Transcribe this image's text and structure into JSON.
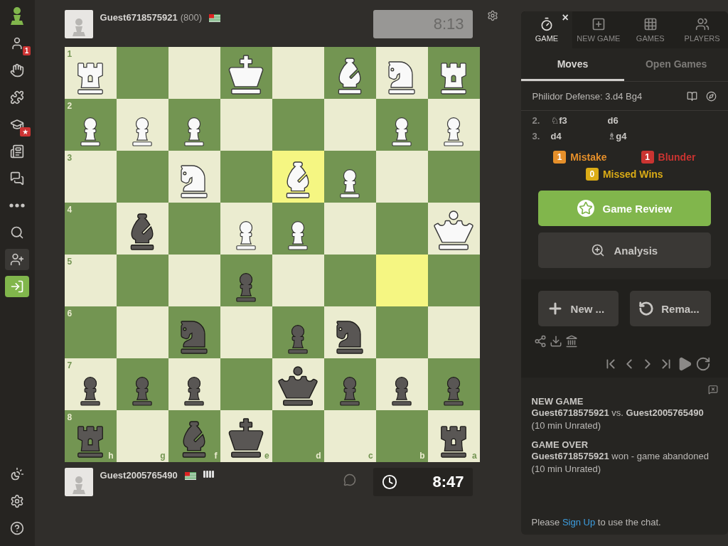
{
  "sidebar": {
    "top_items": [
      {
        "kind": "logo"
      },
      {
        "kind": "plain",
        "badge": "1"
      },
      {
        "kind": "plain"
      },
      {
        "kind": "plain"
      },
      {
        "kind": "plain",
        "badge": "★"
      },
      {
        "kind": "plain"
      },
      {
        "kind": "plain"
      },
      {
        "kind": "plain"
      },
      {
        "kind": "plain"
      },
      {
        "kind": "muted"
      },
      {
        "kind": "primary"
      }
    ]
  },
  "top_player": {
    "name": "Guest6718575921",
    "rating": "(800)",
    "clock": "8:13",
    "clock_active": false
  },
  "bottom_player": {
    "name": "Guest2005765490",
    "clock": "8:47",
    "clock_active": true
  },
  "board": {
    "files": [
      "h",
      "g",
      "f",
      "e",
      "d",
      "c",
      "b",
      "a"
    ],
    "rows": [
      {
        "rank": "1",
        "squares": [
          {
            "kind": "rook",
            "white": true,
            "highlighted": false
          },
          {
            "kind": "empty",
            "highlighted": false
          },
          {
            "kind": "empty",
            "highlighted": false
          },
          {
            "kind": "king",
            "white": true,
            "highlighted": false
          },
          {
            "kind": "empty",
            "highlighted": false
          },
          {
            "kind": "bishop",
            "white": true,
            "highlighted": false
          },
          {
            "kind": "knight",
            "white": true,
            "highlighted": false
          },
          {
            "kind": "rook",
            "white": true,
            "highlighted": false
          }
        ]
      },
      {
        "rank": "2",
        "squares": [
          {
            "kind": "pawn",
            "white": true,
            "highlighted": false
          },
          {
            "kind": "pawn",
            "white": true,
            "highlighted": false
          },
          {
            "kind": "pawn",
            "white": true,
            "highlighted": false
          },
          {
            "kind": "empty",
            "highlighted": false
          },
          {
            "kind": "empty",
            "highlighted": false
          },
          {
            "kind": "empty",
            "highlighted": false
          },
          {
            "kind": "pawn",
            "white": true,
            "highlighted": false
          },
          {
            "kind": "pawn",
            "white": true,
            "highlighted": false
          }
        ]
      },
      {
        "rank": "3",
        "squares": [
          {
            "kind": "empty",
            "highlighted": false
          },
          {
            "kind": "empty",
            "highlighted": false
          },
          {
            "kind": "knight",
            "white": true,
            "highlighted": false
          },
          {
            "kind": "empty",
            "highlighted": false
          },
          {
            "kind": "bishop",
            "white": true,
            "highlighted": true
          },
          {
            "kind": "pawn",
            "white": true,
            "highlighted": false
          },
          {
            "kind": "empty",
            "highlighted": false
          },
          {
            "kind": "empty",
            "highlighted": false
          }
        ]
      },
      {
        "rank": "4",
        "squares": [
          {
            "kind": "empty",
            "highlighted": false
          },
          {
            "kind": "bishop",
            "white": false,
            "highlighted": false
          },
          {
            "kind": "empty",
            "highlighted": false
          },
          {
            "kind": "pawn",
            "white": true,
            "highlighted": false
          },
          {
            "kind": "pawn",
            "white": true,
            "highlighted": false
          },
          {
            "kind": "empty",
            "highlighted": false
          },
          {
            "kind": "empty",
            "highlighted": false
          },
          {
            "kind": "queen",
            "white": true,
            "highlighted": false
          }
        ]
      },
      {
        "rank": "5",
        "squares": [
          {
            "kind": "empty",
            "highlighted": false
          },
          {
            "kind": "empty",
            "highlighted": false
          },
          {
            "kind": "empty",
            "highlighted": false
          },
          {
            "kind": "pawn",
            "white": false,
            "highlighted": false
          },
          {
            "kind": "empty",
            "highlighted": false
          },
          {
            "kind": "empty",
            "highlighted": false
          },
          {
            "kind": "empty",
            "highlighted": true
          },
          {
            "kind": "empty",
            "highlighted": false
          }
        ]
      },
      {
        "rank": "6",
        "squares": [
          {
            "kind": "empty",
            "highlighted": false
          },
          {
            "kind": "empty",
            "highlighted": false
          },
          {
            "kind": "knight",
            "white": false,
            "highlighted": false
          },
          {
            "kind": "empty",
            "highlighted": false
          },
          {
            "kind": "pawn",
            "white": false,
            "highlighted": false
          },
          {
            "kind": "knight",
            "white": false,
            "highlighted": false
          },
          {
            "kind": "empty",
            "highlighted": false
          },
          {
            "kind": "empty",
            "highlighted": false
          }
        ]
      },
      {
        "rank": "7",
        "squares": [
          {
            "kind": "pawn",
            "white": false,
            "highlighted": false
          },
          {
            "kind": "pawn",
            "white": false,
            "highlighted": false
          },
          {
            "kind": "pawn",
            "white": false,
            "highlighted": false
          },
          {
            "kind": "empty",
            "highlighted": false
          },
          {
            "kind": "queen",
            "white": false,
            "highlighted": false
          },
          {
            "kind": "pawn",
            "white": false,
            "highlighted": false
          },
          {
            "kind": "pawn",
            "white": false,
            "highlighted": false
          },
          {
            "kind": "pawn",
            "white": false,
            "highlighted": false
          }
        ]
      },
      {
        "rank": "8",
        "squares": [
          {
            "kind": "rook",
            "white": false,
            "highlighted": false
          },
          {
            "kind": "empty",
            "highlighted": false
          },
          {
            "kind": "bishop",
            "white": false,
            "highlighted": false
          },
          {
            "kind": "king",
            "white": false,
            "highlighted": false
          },
          {
            "kind": "empty",
            "highlighted": false
          },
          {
            "kind": "empty",
            "highlighted": false
          },
          {
            "kind": "empty",
            "highlighted": false
          },
          {
            "kind": "rook",
            "white": false,
            "highlighted": false
          }
        ]
      }
    ]
  },
  "panel": {
    "nav_tabs": [
      {
        "label": "GAME",
        "selected": true
      },
      {
        "label": "NEW GAME",
        "selected": false
      },
      {
        "label": "GAMES",
        "selected": false
      },
      {
        "label": "PLAYERS",
        "selected": false
      }
    ],
    "close": "×",
    "sub_tabs": [
      {
        "label": "Moves",
        "selected": true
      },
      {
        "label": "Open Games",
        "selected": false
      }
    ],
    "opening": "Philidor Defense: 3.d4 Bg4",
    "moves": [
      {
        "number": "2.",
        "white": "♘f3",
        "black": "d6"
      },
      {
        "number": "3.",
        "white": "d4",
        "black": "♗g4"
      }
    ],
    "summary": [
      {
        "count": "1",
        "label": "Mistake",
        "color": "#e58f2a"
      },
      {
        "count": "1",
        "label": "Blunder",
        "color": "#ca3431"
      },
      {
        "count": "0",
        "label": "Missed Wins",
        "color": "#dbac16"
      }
    ],
    "review_button": "Game Review",
    "analysis_button": "Analysis",
    "new_button": "New ...",
    "rematch_button": "Rema...",
    "chat": {
      "messages": [
        {
          "title": "NEW GAME",
          "body": "**Guest6718575921** vs. **Guest2005765490** (10 min Unrated)"
        },
        {
          "title": "GAME OVER",
          "body": "**Guest6718575921** won - game abandoned (10 min Unrated)"
        }
      ],
      "footer_before": "Please",
      "footer_link": "Sign Up",
      "footer_after": "to use the chat."
    }
  }
}
